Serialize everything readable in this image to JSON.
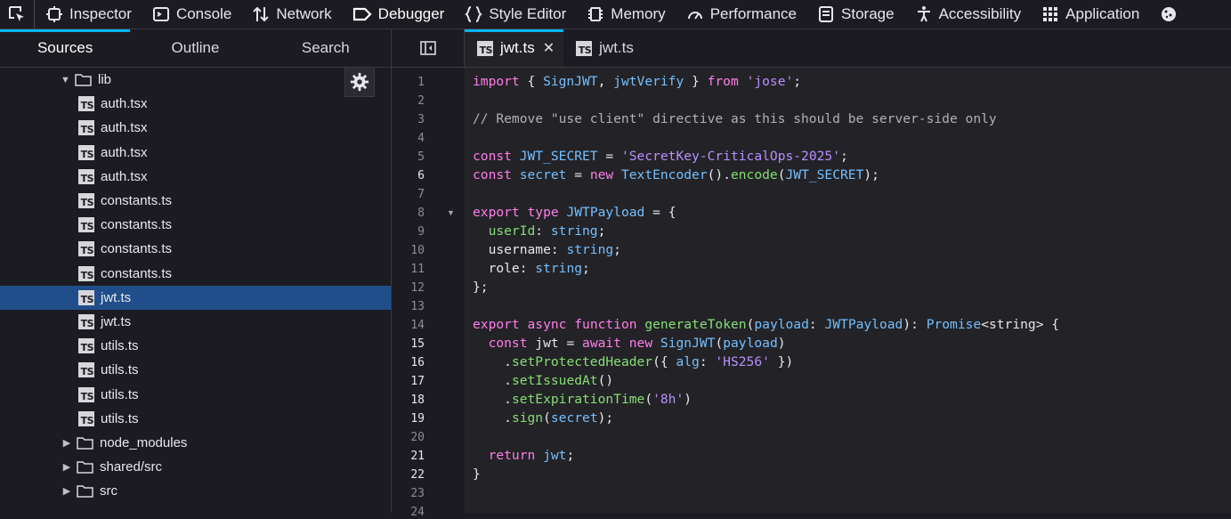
{
  "toolbar": {
    "tools": [
      {
        "label": "Inspector",
        "icon": "inspector-icon"
      },
      {
        "label": "Console",
        "icon": "console-icon"
      },
      {
        "label": "Network",
        "icon": "network-icon"
      },
      {
        "label": "Debugger",
        "icon": "debugger-icon",
        "active": true
      },
      {
        "label": "Style Editor",
        "icon": "style-editor-icon"
      },
      {
        "label": "Memory",
        "icon": "memory-icon"
      },
      {
        "label": "Performance",
        "icon": "performance-icon"
      },
      {
        "label": "Storage",
        "icon": "storage-icon"
      },
      {
        "label": "Accessibility",
        "icon": "accessibility-icon"
      },
      {
        "label": "Application",
        "icon": "application-icon"
      }
    ]
  },
  "left_tabs": [
    "Sources",
    "Outline",
    "Search"
  ],
  "tree": {
    "folder": "lib",
    "files": [
      "auth.tsx",
      "auth.tsx",
      "auth.tsx",
      "auth.tsx",
      "constants.ts",
      "constants.ts",
      "constants.ts",
      "constants.ts",
      "jwt.ts",
      "jwt.ts",
      "utils.ts",
      "utils.ts",
      "utils.ts",
      "utils.ts"
    ],
    "selected_index": 8,
    "folders": [
      "node_modules",
      "shared/src",
      "src"
    ]
  },
  "editor_tabs": [
    {
      "label": "jwt.ts",
      "active": true
    },
    {
      "label": "jwt.ts",
      "active": false
    }
  ],
  "file_icon_label": "TS",
  "current_lines": [
    6,
    15,
    16,
    17,
    18,
    19,
    21,
    22
  ],
  "code": [
    [
      [
        "kw",
        "import"
      ],
      [
        "pl",
        " { "
      ],
      [
        "id",
        "SignJWT"
      ],
      [
        "pl",
        ", "
      ],
      [
        "id",
        "jwtVerify"
      ],
      [
        "pl",
        " } "
      ],
      [
        "kw",
        "from"
      ],
      [
        "pl",
        " "
      ],
      [
        "str",
        "'jose'"
      ],
      [
        "pl",
        ";"
      ]
    ],
    [],
    [
      [
        "cm",
        "// Remove \"use client\" directive as this should be server-side only"
      ]
    ],
    [],
    [
      [
        "kw",
        "const"
      ],
      [
        "pl",
        " "
      ],
      [
        "id",
        "JWT_SECRET"
      ],
      [
        "pl",
        " = "
      ],
      [
        "str",
        "'SecretKey-CriticalOps-2025'"
      ],
      [
        "pl",
        ";"
      ]
    ],
    [
      [
        "kw",
        "const"
      ],
      [
        "pl",
        " "
      ],
      [
        "id",
        "secret"
      ],
      [
        "pl",
        " = "
      ],
      [
        "kw",
        "new"
      ],
      [
        "pl",
        " "
      ],
      [
        "id",
        "TextEncoder"
      ],
      [
        "pl",
        "()."
      ],
      [
        "fn",
        "encode"
      ],
      [
        "pl",
        "("
      ],
      [
        "id",
        "JWT_SECRET"
      ],
      [
        "pl",
        ");"
      ]
    ],
    [],
    [
      [
        "kw",
        "export"
      ],
      [
        "pl",
        " "
      ],
      [
        "kw",
        "type"
      ],
      [
        "pl",
        " "
      ],
      [
        "id",
        "JWTPayload"
      ],
      [
        "pl",
        " = {"
      ]
    ],
    [
      [
        "pl",
        "  "
      ],
      [
        "fn",
        "userId"
      ],
      [
        "pl",
        ": "
      ],
      [
        "id",
        "string"
      ],
      [
        "pl",
        ";"
      ]
    ],
    [
      [
        "pl",
        "  username: "
      ],
      [
        "id",
        "string"
      ],
      [
        "pl",
        ";"
      ]
    ],
    [
      [
        "pl",
        "  role: "
      ],
      [
        "id",
        "string"
      ],
      [
        "pl",
        ";"
      ]
    ],
    [
      [
        "pl",
        "};"
      ]
    ],
    [],
    [
      [
        "kw",
        "export"
      ],
      [
        "pl",
        " "
      ],
      [
        "kw",
        "async"
      ],
      [
        "pl",
        " "
      ],
      [
        "kw",
        "function"
      ],
      [
        "pl",
        " "
      ],
      [
        "fn",
        "generateToken"
      ],
      [
        "pl",
        "("
      ],
      [
        "id",
        "payload"
      ],
      [
        "pl",
        ": "
      ],
      [
        "id",
        "JWTPayload"
      ],
      [
        "pl",
        "): "
      ],
      [
        "id",
        "Promise"
      ],
      [
        "pl",
        "<string> {"
      ]
    ],
    [
      [
        "pl",
        "  "
      ],
      [
        "kw",
        "const"
      ],
      [
        "pl",
        " jwt = "
      ],
      [
        "kw",
        "await"
      ],
      [
        "pl",
        " "
      ],
      [
        "kw",
        "new"
      ],
      [
        "pl",
        " "
      ],
      [
        "id",
        "SignJWT"
      ],
      [
        "pl",
        "("
      ],
      [
        "id",
        "payload"
      ],
      [
        "pl",
        ")"
      ]
    ],
    [
      [
        "pl",
        "    ."
      ],
      [
        "fn",
        "setProtectedHeader"
      ],
      [
        "pl",
        "({ "
      ],
      [
        "id",
        "alg"
      ],
      [
        "pl",
        ": "
      ],
      [
        "str",
        "'HS256'"
      ],
      [
        "pl",
        " })"
      ]
    ],
    [
      [
        "pl",
        "    ."
      ],
      [
        "fn",
        "setIssuedAt"
      ],
      [
        "pl",
        "()"
      ]
    ],
    [
      [
        "pl",
        "    ."
      ],
      [
        "fn",
        "setExpirationTime"
      ],
      [
        "pl",
        "("
      ],
      [
        "str",
        "'8h'"
      ],
      [
        "pl",
        ")"
      ]
    ],
    [
      [
        "pl",
        "    ."
      ],
      [
        "fn",
        "sign"
      ],
      [
        "pl",
        "("
      ],
      [
        "id",
        "secret"
      ],
      [
        "pl",
        ");"
      ]
    ],
    [],
    [
      [
        "pl",
        "  "
      ],
      [
        "kw",
        "return"
      ],
      [
        "pl",
        " "
      ],
      [
        "id",
        "jwt"
      ],
      [
        "pl",
        ";"
      ]
    ],
    [
      [
        "pl",
        "}"
      ]
    ],
    []
  ]
}
